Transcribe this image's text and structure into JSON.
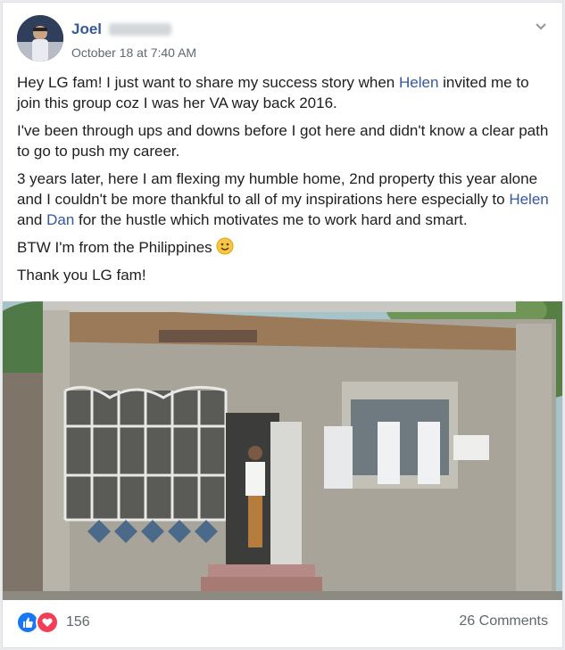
{
  "post": {
    "author_name": "Joel",
    "timestamp": "October 18 at 7:40 AM",
    "paragraphs": {
      "p1": {
        "before": "Hey LG fam! I just want to share my success story when ",
        "link1": "Helen",
        "after": " invited me to join this group coz I was her VA way back 2016."
      },
      "p2": "I've been through ups and downs before I got here and didn't know a clear path to go to push my career.",
      "p3": {
        "before": "3 years later, here I am flexing my humble home, 2nd property this year alone and I couldn't be more thankful to all of my inspirations here especially to ",
        "link1": "Helen",
        "mid": " and ",
        "link2": "Dan",
        "after": " for the hustle which motivates me to work hard and smart."
      },
      "p4": "BTW I'm from the Philippines",
      "p5": "Thank you LG fam!"
    },
    "icons": {
      "options": "chevron-down-icon",
      "emoji": "smiley-icon",
      "like": "like-icon",
      "love": "love-icon"
    },
    "colors": {
      "link": "#365899",
      "like": "#1877f2",
      "love": "#f33e58",
      "text": "#1c1e21",
      "meta": "#616770"
    }
  },
  "footer": {
    "reaction_count": "156",
    "comments_label": "26 Comments"
  }
}
